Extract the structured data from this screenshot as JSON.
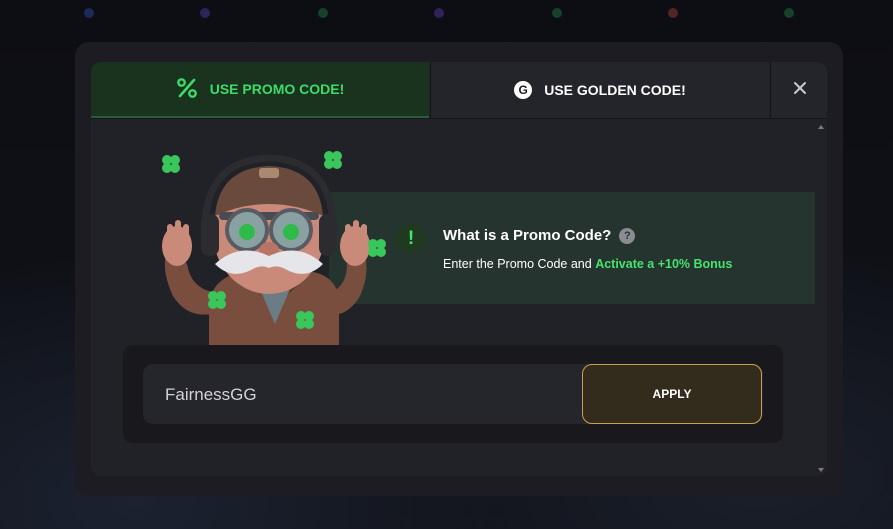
{
  "tabs": {
    "promo_label": "USE PROMO CODE!",
    "golden_label": "USE GOLDEN CODE!",
    "golden_icon_letter": "G"
  },
  "info": {
    "icon_glyph": "!",
    "title": "What is a Promo Code?",
    "help_glyph": "?",
    "text_plain": "Enter the Promo Code and ",
    "text_highlight": "Activate a +10% Bonus"
  },
  "promo_input": {
    "value": "FairnessGG"
  },
  "apply_label": "APPLY",
  "colors": {
    "accent_green": "#45e46e",
    "apply_border": "#c9a24a",
    "modal_bg": "#1c1c22"
  },
  "icons": [
    "percent-icon",
    "golden-g-icon",
    "close-icon",
    "exclamation-icon",
    "help-icon",
    "clover-icon"
  ]
}
